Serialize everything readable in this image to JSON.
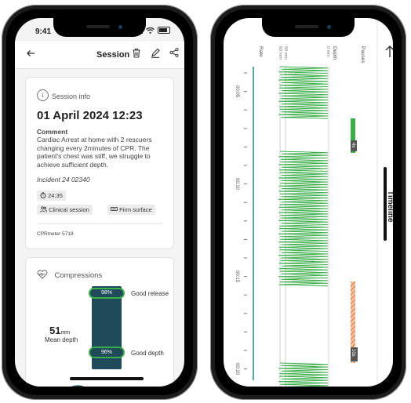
{
  "left_phone": {
    "status_time": "9:41",
    "appbar": {
      "back_icon": "arrow-left-icon",
      "title": "Session",
      "actions": [
        "trash-icon",
        "pencil-icon",
        "share-icon"
      ]
    },
    "info": {
      "heading": "Session info",
      "date": "01 April 2024 12:23",
      "comment_label": "Comment",
      "comment": "Cardiac Arrest at home with 2 rescuers changing every 2minutes of CPR. The patient's chest was stiff, we struggle to achieve sufficient depth.",
      "incident": "Incident 24 02340",
      "duration": "24:35",
      "tag_clinical": "Clinical session",
      "tag_surface": "Firm surface",
      "device": "CPRmeter 5718"
    },
    "compressions": {
      "heading": "Compressions",
      "release_pct": "98%",
      "release_label": "Good release",
      "depth_value": "51",
      "depth_unit": "mm",
      "depth_caption": "Mean depth",
      "depth_pct": "96%",
      "depth_label": "Good depth",
      "release_fraction": 0.98,
      "depth_fraction": 0.96
    },
    "colors": {
      "accent_green": "#3cae4a",
      "bar_teal": "#1e4a5a"
    }
  },
  "right_phone": {
    "title": "Timeline",
    "back_icon": "arrow-left-icon",
    "rows": {
      "pauses": "Pauses",
      "depth": "Depth",
      "depth_scale_top": "0 mm",
      "depth_scale_mid": "50 mm",
      "depth_scale_low": "60 mm",
      "rate": "Rate"
    },
    "time_ticks": [
      "00:05",
      "00:10",
      "00:15",
      "00:20"
    ],
    "pause_short_label": "4s",
    "pause_long_label": "10s",
    "colors": {
      "waveform": "#3cae4a",
      "pause_short": "#3cae4a",
      "pause_long": "#e2743a",
      "rate_line": "#2a8a8a"
    }
  }
}
